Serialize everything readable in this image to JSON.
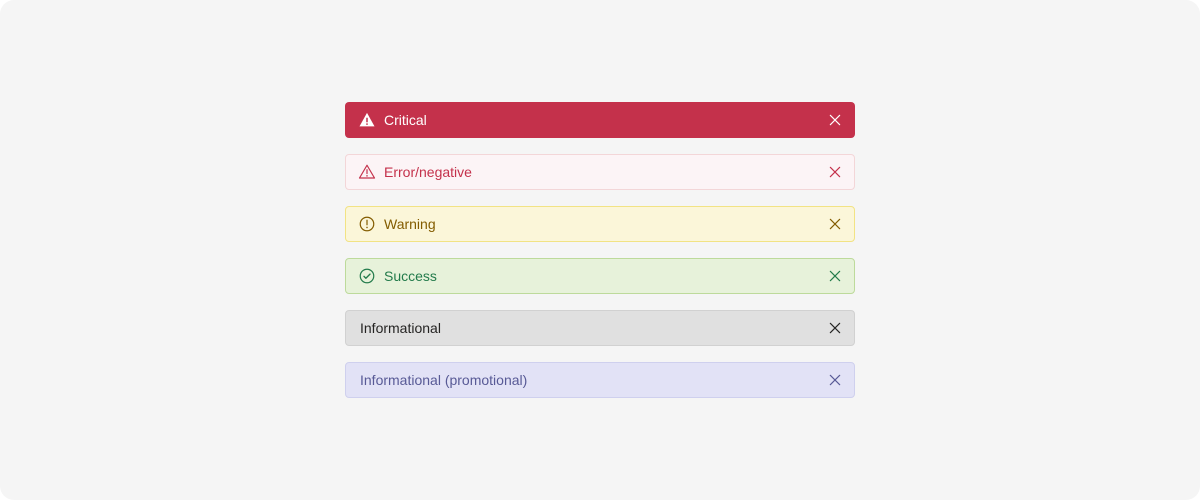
{
  "banners": {
    "critical": {
      "label": "Critical",
      "icon": "alert-triangle-filled",
      "bg": "#c4314b",
      "fg": "#ffffff"
    },
    "error": {
      "label": "Error/negative",
      "icon": "alert-triangle-outline",
      "bg": "#fcf4f6",
      "fg": "#c4314b",
      "border": "#f3d6d8"
    },
    "warning": {
      "label": "Warning",
      "icon": "alert-circle-outline",
      "bg": "#fbf6d9",
      "fg": "#835c00",
      "border": "#f2e384"
    },
    "success": {
      "label": "Success",
      "icon": "check-circle-outline",
      "bg": "#e7f2da",
      "fg": "#237b4b",
      "border": "#bdda9b"
    },
    "info": {
      "label": "Informational",
      "icon": "",
      "bg": "#e0e0e0",
      "fg": "#252423",
      "border": "#d1d1d1"
    },
    "promo": {
      "label": "Informational (promotional)",
      "icon": "",
      "bg": "#e2e2f6",
      "fg": "#585a96",
      "border": "#cfd0ee"
    }
  }
}
